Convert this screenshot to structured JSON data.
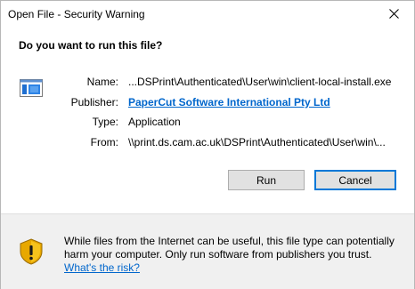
{
  "window": {
    "title": "Open File - Security Warning",
    "close_icon": "close-icon"
  },
  "dialog": {
    "heading": "Do you want to run this file?",
    "file_icon": "application-window-icon",
    "fields": {
      "name_label": "Name:",
      "name_value": "...DSPrint\\Authenticated\\User\\win\\client-local-install.exe",
      "publisher_label": "Publisher:",
      "publisher_value": "PaperCut Software International Pty Ltd",
      "type_label": "Type:",
      "type_value": "Application",
      "from_label": "From:",
      "from_value": "\\\\print.ds.cam.ac.uk\\DSPrint\\Authenticated\\User\\win\\..."
    },
    "buttons": {
      "run_label": "Run",
      "cancel_label": "Cancel"
    }
  },
  "warning": {
    "icon": "shield-warning-icon",
    "message": "While files from the Internet can be useful, this file type can potentially harm your computer. Only run software from publishers you trust.",
    "link_label": "What's the risk?"
  },
  "colors": {
    "link": "#0066cc",
    "focus_border": "#0078d7",
    "panel_bg": "#f0f0f0",
    "button_bg": "#e1e1e1"
  }
}
